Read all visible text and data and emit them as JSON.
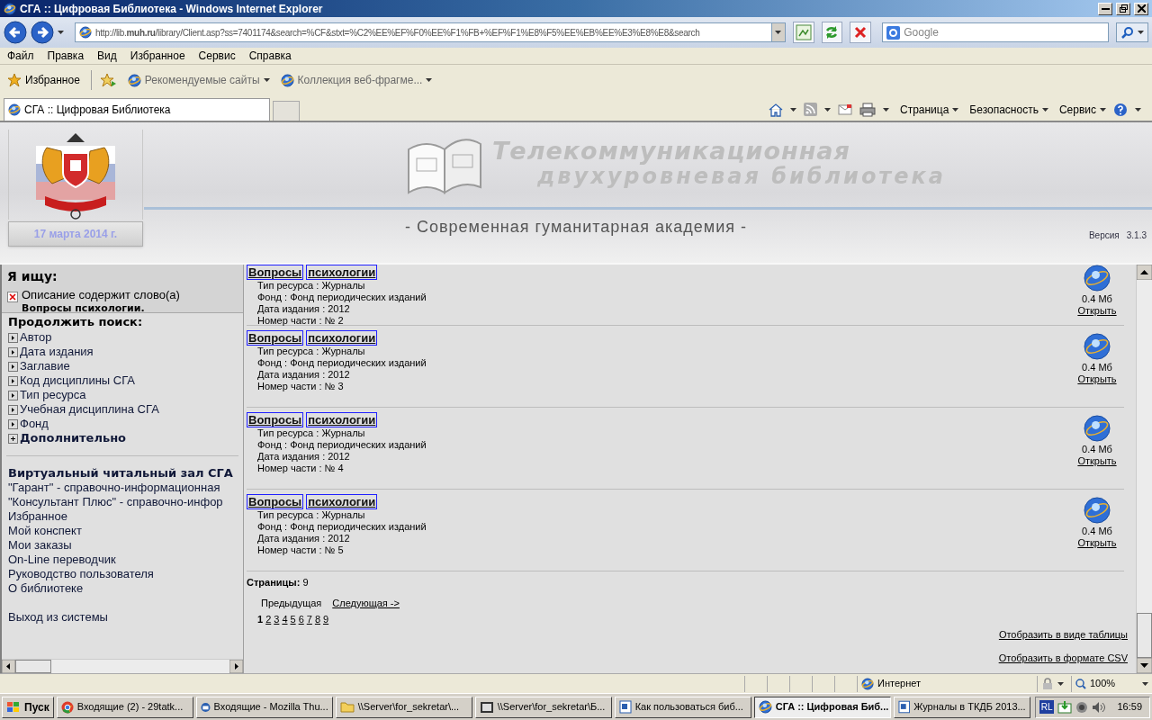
{
  "window": {
    "title": "СГА :: Цифровая Библиотека - Windows Internet Explorer"
  },
  "address_bar": {
    "url": "http://lib.**muh.ru**/library/Client.asp?ss=7401174&search=%CF&stxt=%C2%EE%EF%F0%EE%F1%FB+%EF%F1%E8%F5%EE%EB%EE%E3%E8%E8&search",
    "search_placeholder": "Google"
  },
  "menu": [
    "Файл",
    "Правка",
    "Вид",
    "Избранное",
    "Сервис",
    "Справка"
  ],
  "favorites_bar": {
    "favorites": "Избранное",
    "links": [
      "Рекомендуемые сайты",
      "Коллекция веб-фрагме..."
    ]
  },
  "tabs": [
    {
      "label": "СГА :: Цифровая Библиотека",
      "selected": true
    }
  ],
  "command_bar": [
    "Страница",
    "Безопасность",
    "Сервис"
  ],
  "header": {
    "library_title": [
      "Телекоммуникационная",
      "двухуровневая библиотека"
    ],
    "date": "17 марта 2014 г.",
    "subtitle": "- Современная гуманитарная академия -",
    "version_label": "Версия",
    "version": "3.1.3"
  },
  "sidebar": {
    "search_heading": "Я ищу:",
    "criterion": {
      "label": "Описание содержит слово(а)",
      "value": "Вопросы психологии."
    },
    "continue_heading": "Продолжить поиск:",
    "filters": [
      {
        "label": "Автор",
        "kind": "arrow"
      },
      {
        "label": "Дата издания",
        "kind": "arrow"
      },
      {
        "label": "Заглавие",
        "kind": "arrow"
      },
      {
        "label": "Код дисциплины СГА",
        "kind": "arrow"
      },
      {
        "label": "Тип ресурса",
        "kind": "arrow"
      },
      {
        "label": "Учебная дисциплина СГА",
        "kind": "arrow"
      },
      {
        "label": "Фонд",
        "kind": "arrow"
      },
      {
        "label": "Дополнительно",
        "kind": "plus"
      }
    ],
    "links": [
      {
        "label": "Виртуальный читальный зал СГА",
        "kind": "heading"
      },
      {
        "label": "\"Гарант\" - справочно-информационная",
        "kind": "link"
      },
      {
        "label": "\"Консультант Плюс\" - справочно-инфор",
        "kind": "link"
      },
      {
        "label": "Избранное",
        "kind": "link"
      },
      {
        "label": "Мой конспект",
        "kind": "link"
      },
      {
        "label": "Мои заказы",
        "kind": "link"
      },
      {
        "label": "On-Line переводчик",
        "kind": "link"
      },
      {
        "label": "Руководство пользователя",
        "kind": "link"
      },
      {
        "label": "О библиотеке",
        "kind": "link"
      },
      {
        "label": "Выход из системы",
        "kind": "gap"
      }
    ]
  },
  "results": [
    {
      "title_words": [
        "Вопросы",
        "психологии"
      ],
      "fields": [
        {
          "label": "Тип ресурса :",
          "value": "Журналы"
        },
        {
          "label": "Фонд :",
          "value": "Фонд периодических изданий"
        },
        {
          "label": "Дата издания :",
          "value": "2012"
        },
        {
          "label": "Номер части :",
          "value": "№ 2"
        }
      ],
      "size": "0.4 Мб",
      "open": "Открыть"
    },
    {
      "title_words": [
        "Вопросы",
        "психологии"
      ],
      "fields": [
        {
          "label": "Тип ресурса :",
          "value": "Журналы"
        },
        {
          "label": "Фонд :",
          "value": "Фонд периодических изданий"
        },
        {
          "label": "Дата издания :",
          "value": "2012"
        },
        {
          "label": "Номер части :",
          "value": "№ 3"
        }
      ],
      "size": "0.4 Мб",
      "open": "Открыть"
    },
    {
      "title_words": [
        "Вопросы",
        "психологии"
      ],
      "fields": [
        {
          "label": "Тип ресурса :",
          "value": "Журналы"
        },
        {
          "label": "Фонд :",
          "value": "Фонд периодических изданий"
        },
        {
          "label": "Дата издания :",
          "value": "2012"
        },
        {
          "label": "Номер части :",
          "value": "№ 4"
        }
      ],
      "size": "0.4 Мб",
      "open": "Открыть"
    },
    {
      "title_words": [
        "Вопросы",
        "психологии"
      ],
      "fields": [
        {
          "label": "Тип ресурса :",
          "value": "Журналы"
        },
        {
          "label": "Фонд :",
          "value": "Фонд периодических изданий"
        },
        {
          "label": "Дата издания :",
          "value": "2012"
        },
        {
          "label": "Номер части :",
          "value": "№ 5"
        }
      ],
      "size": "0.4 Мб",
      "open": "Открыть"
    }
  ],
  "pagination": {
    "pages_label": "Страницы:",
    "pages_count": "9",
    "prev": "Предыдущая",
    "next": "Следующая ->",
    "pages": [
      {
        "label": "1",
        "selected": true
      },
      {
        "label": "2",
        "selected": false
      },
      {
        "label": "3",
        "selected": false
      },
      {
        "label": "4",
        "selected": false
      },
      {
        "label": "5",
        "selected": false
      },
      {
        "label": "6",
        "selected": false
      },
      {
        "label": "7",
        "selected": false
      },
      {
        "label": "8",
        "selected": false
      },
      {
        "label": "9",
        "selected": false
      }
    ]
  },
  "view_links": [
    "Отобразить в виде таблицы",
    "Отобразить в формате CSV"
  ],
  "status_bar": {
    "zone": "Интернет",
    "zoom": "100%"
  },
  "taskbar": {
    "start": "Пуск",
    "tasks": [
      {
        "label": "Входящие (2) - 29tatk...",
        "kind": "browser",
        "selected": false
      },
      {
        "label": "Входящие - Mozilla Thu...",
        "kind": "mail",
        "selected": false
      },
      {
        "label": "\\\\Server\\for_sekretar\\...",
        "kind": "folder",
        "selected": false
      },
      {
        "label": "\\\\Server\\for_sekretar\\Б...",
        "kind": "app",
        "selected": false
      },
      {
        "label": "Как пользоваться биб...",
        "kind": "document",
        "selected": false
      },
      {
        "label": "СГА :: Цифровая Биб...",
        "kind": "ie",
        "selected": true
      },
      {
        "label": "Журналы в ТКДБ 2013...",
        "kind": "document",
        "selected": false
      }
    ],
    "language": "RL",
    "clock": "16:59"
  }
}
